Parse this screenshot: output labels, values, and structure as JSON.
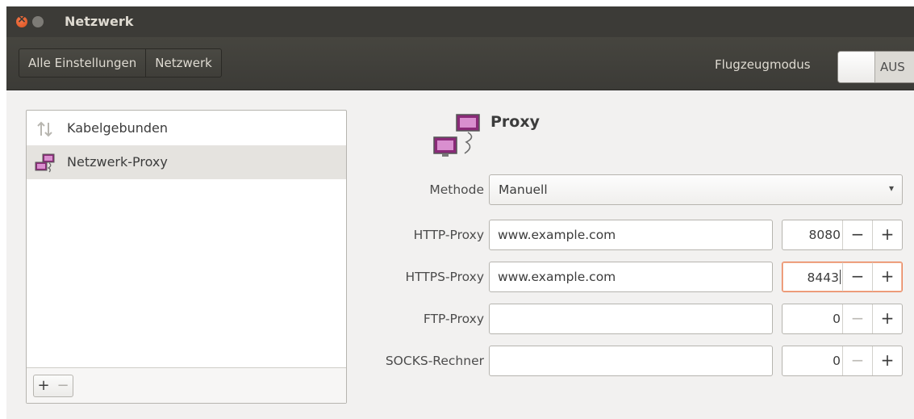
{
  "window": {
    "title": "Netzwerk"
  },
  "header": {
    "breadcrumbs": [
      "Alle Einstellungen",
      "Netzwerk"
    ],
    "flight_mode_label": "Flugzeugmodus",
    "flight_mode_state": "AUS"
  },
  "sidebar": {
    "items": [
      {
        "label": "Kabelgebunden",
        "icon": "wired-network-icon",
        "selected": false
      },
      {
        "label": "Netzwerk-Proxy",
        "icon": "network-proxy-icon",
        "selected": true
      }
    ],
    "add_label": "+",
    "remove_label": "−"
  },
  "panel": {
    "title": "Proxy",
    "method_label": "Methode",
    "method_value": "Manuell",
    "rows": [
      {
        "label": "HTTP-Proxy",
        "host": "www.example.com",
        "port": "8080"
      },
      {
        "label": "HTTPS-Proxy",
        "host": "www.example.com",
        "port": "8443"
      },
      {
        "label": "FTP-Proxy",
        "host": "",
        "port": "0"
      },
      {
        "label": "SOCKS-Rechner",
        "host": "",
        "port": "0"
      }
    ],
    "minus_label": "−",
    "plus_label": "+"
  },
  "colors": {
    "titlebar": "#3c3b37",
    "close_button": "#e25a2a",
    "focus_border": "#e9845c",
    "proxy_icon": "#8a2a78"
  }
}
